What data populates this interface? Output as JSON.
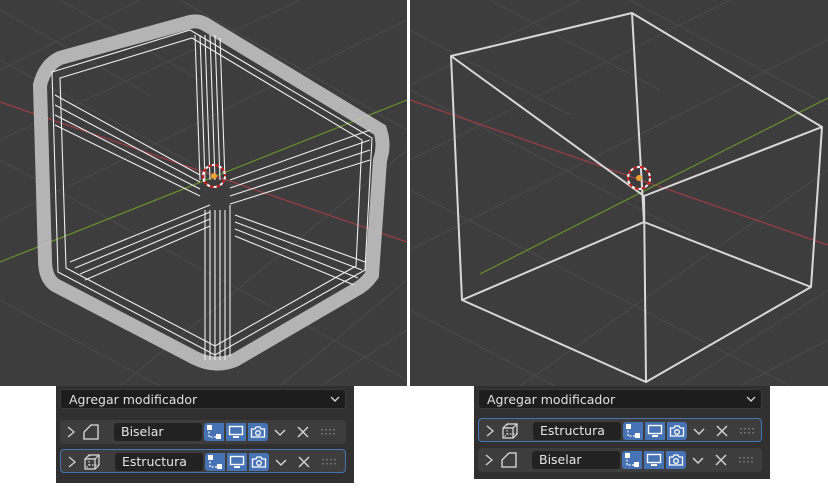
{
  "left": {
    "add_modifier_label": "Agregar modificador",
    "modifiers": [
      {
        "name": "Biselar",
        "type_icon": "bevel-icon",
        "active": false
      },
      {
        "name": "Estructura",
        "type_icon": "wireframe-icon",
        "active": true
      }
    ]
  },
  "right": {
    "add_modifier_label": "Agregar modificador",
    "modifiers": [
      {
        "name": "Estructura",
        "type_icon": "wireframe-icon",
        "active": true
      },
      {
        "name": "Biselar",
        "type_icon": "bevel-icon",
        "active": false
      }
    ]
  },
  "toggles": [
    "edit-mode-icon",
    "realtime-viewport-icon",
    "render-camera-icon"
  ],
  "colors": {
    "viewport_bg": "#3d3d3d",
    "panel_bg": "#303030",
    "accent_blue": "#4772b3",
    "x_axis": "#9b3d49",
    "y_axis": "#6b8f2e",
    "wire": "#d8d8d8"
  }
}
